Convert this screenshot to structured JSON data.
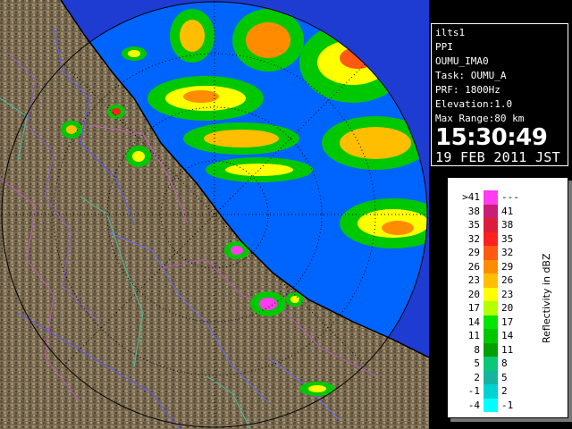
{
  "info": {
    "radar": "ilts1",
    "scan_type": "PPI",
    "site": "OUMU_IMA0",
    "task": "Task: OUMU_A",
    "prf": "PRF: 1800Hz",
    "elevation": "Elevation:1.0",
    "max_range": "Max Range:80 km",
    "time": "15:30:49",
    "date": "19 FEB 2011 JST"
  },
  "legend": {
    "unit": "Reflectivity in dBZ",
    "rows": [
      {
        "left": ">41",
        "right": "---",
        "color": "#ff3cf0"
      },
      {
        "left": "38",
        "right": "41",
        "color": "#c81e78"
      },
      {
        "left": "35",
        "right": "38",
        "color": "#dc1e3c"
      },
      {
        "left": "32",
        "right": "35",
        "color": "#ff2020"
      },
      {
        "left": "29",
        "right": "32",
        "color": "#ff5a14"
      },
      {
        "left": "26",
        "right": "29",
        "color": "#ff8c00"
      },
      {
        "left": "23",
        "right": "26",
        "color": "#ffbe00"
      },
      {
        "left": "20",
        "right": "23",
        "color": "#ffff00"
      },
      {
        "left": "17",
        "right": "20",
        "color": "#b4ff00"
      },
      {
        "left": "14",
        "right": "17",
        "color": "#00e600"
      },
      {
        "left": "11",
        "right": "14",
        "color": "#00c800"
      },
      {
        "left": "8",
        "right": "11",
        "color": "#00a000"
      },
      {
        "left": "5",
        "right": "8",
        "color": "#0ac878"
      },
      {
        "left": "2",
        "right": "5",
        "color": "#14b4a0"
      },
      {
        "left": "-1",
        "right": "2",
        "color": "#00d2d2"
      },
      {
        "left": "-4",
        "right": "-1",
        "color": "#00ffff"
      }
    ]
  },
  "colors": {
    "sea": "#0064ff",
    "outside_range": "#1e3cd2",
    "land": "#7a6a50"
  }
}
